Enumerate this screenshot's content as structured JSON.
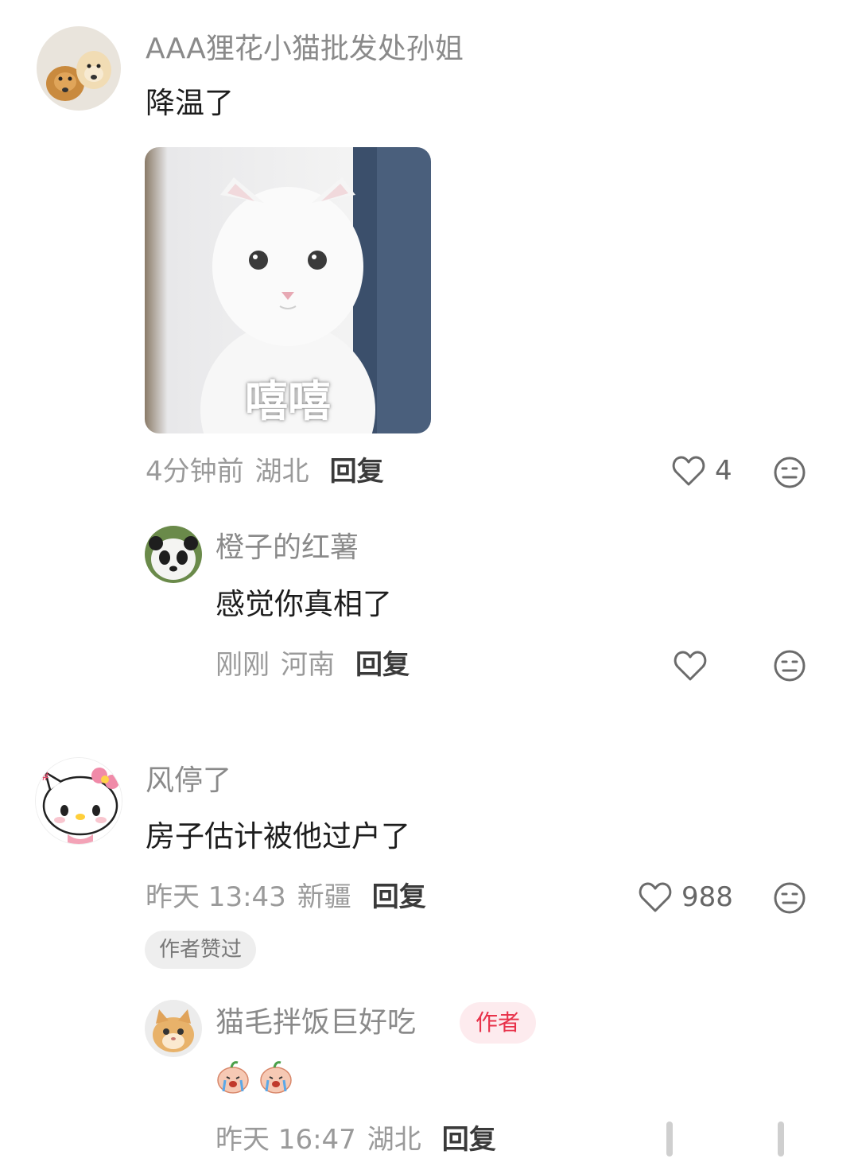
{
  "comments": [
    {
      "user": "AAA狸花小猫批发处孙姐",
      "text": "降温了",
      "sticker_caption": "嘻嘻",
      "time": "4分钟前",
      "location": "湖北",
      "reply_label": "回复",
      "likes": "4"
    },
    {
      "user": "风停了",
      "text": "房子估计被他过户了",
      "time": "昨天 13:43",
      "location": "新疆",
      "reply_label": "回复",
      "likes": "988",
      "author_liked": "作者赞过"
    }
  ],
  "replies": [
    {
      "user": "橙子的红薯",
      "text": "感觉你真相了",
      "time": "刚刚",
      "location": "河南",
      "reply_label": "回复"
    },
    {
      "user": "猫毛拌饭巨好吃",
      "author_tag": "作者",
      "time": "昨天 16:47",
      "location": "湖北",
      "reply_label": "回复"
    }
  ],
  "icons": {
    "like": "heart-outline-icon",
    "dislike": "neutral-face-icon"
  },
  "colors": {
    "author_tag_text": "#e8324a",
    "author_tag_bg": "#fdebee"
  }
}
